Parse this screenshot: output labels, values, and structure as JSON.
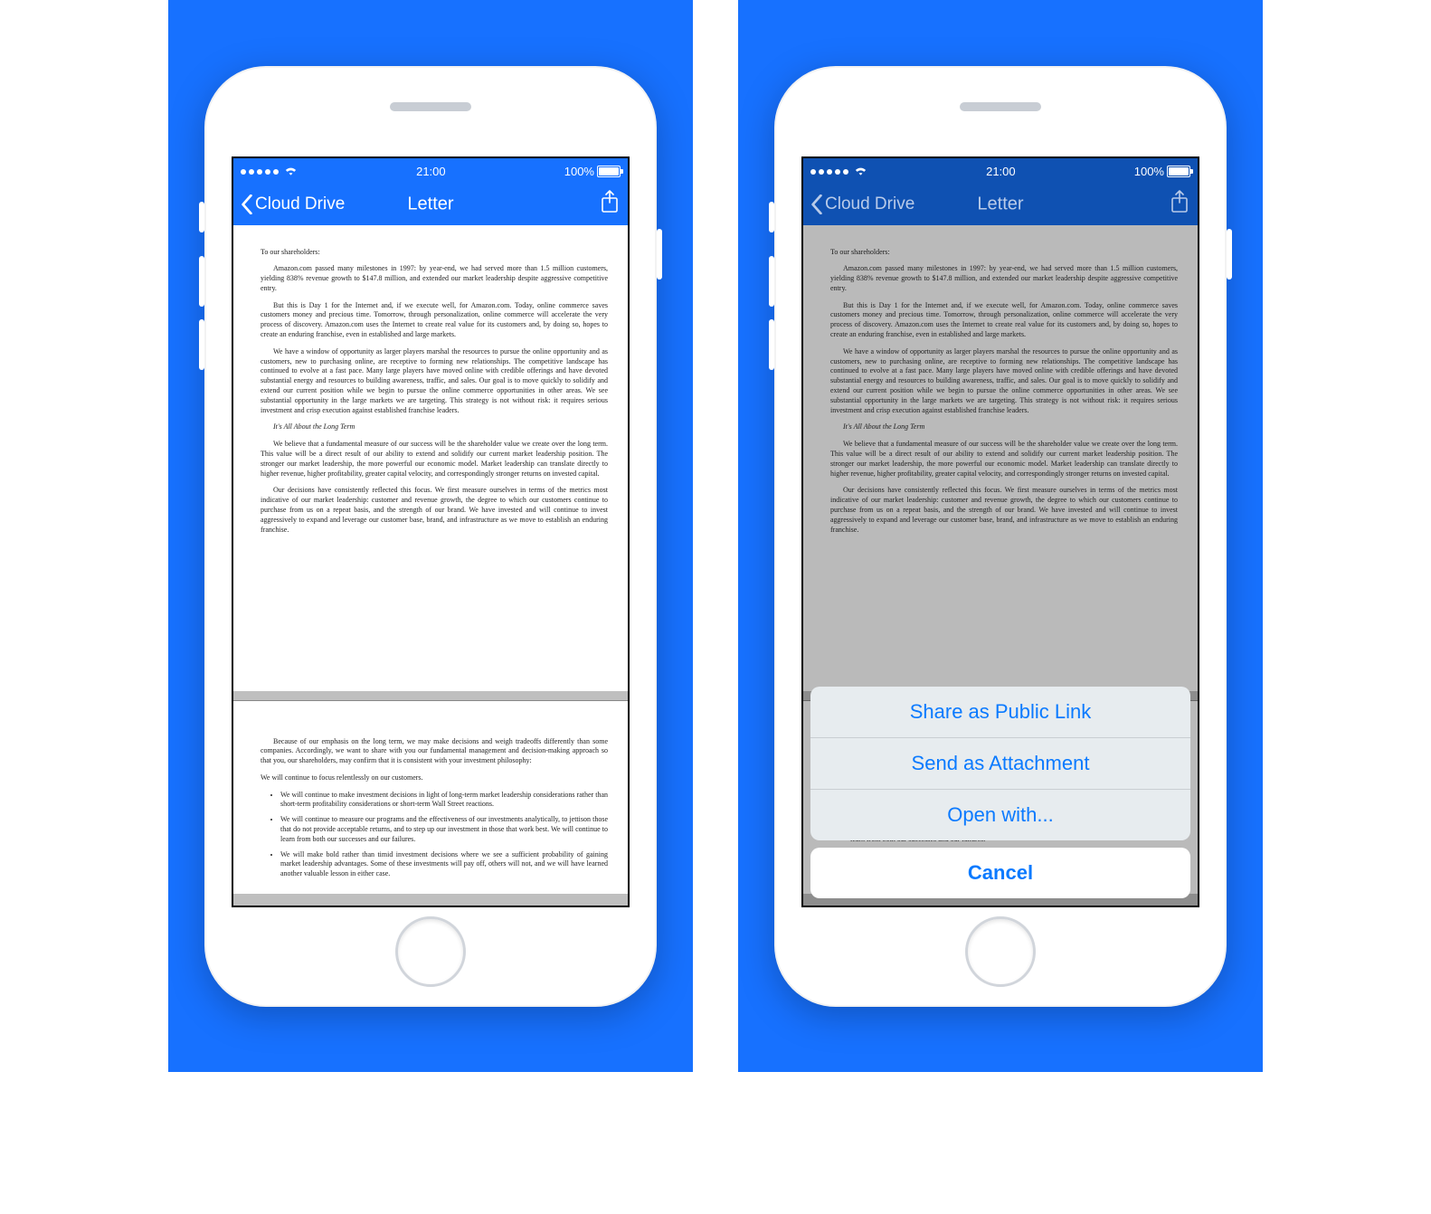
{
  "statusbar": {
    "time": "21:00",
    "battery": "100%"
  },
  "navbar": {
    "back_label": "Cloud Drive",
    "title": "Letter"
  },
  "doc": {
    "greeting": "To our shareholders:",
    "p1": "Amazon.com passed many milestones in 1997: by year-end, we had served more than 1.5 million customers, yielding 838% revenue growth to $147.8 million, and extended our market leadership despite aggressive competitive entry.",
    "p2": "But this is Day 1 for the Internet and, if we execute well, for Amazon.com. Today, online commerce saves customers money and precious time. Tomorrow, through personalization, online commerce will accelerate the very process of discovery. Amazon.com uses the Internet to create real value for its customers and, by doing so, hopes to create an enduring franchise, even in established and large markets.",
    "p3": "We have a window of opportunity as larger players marshal the resources to pursue the online opportunity and as customers, new to purchasing online, are receptive to forming new relationships. The competitive landscape has continued to evolve at a fast pace. Many large players have moved online with credible offerings and have devoted substantial energy and resources to building awareness, traffic, and sales. Our goal is to move quickly to solidify and extend our current position while we begin to pursue the online commerce opportunities in other areas. We see substantial opportunity in the large markets we are targeting. This strategy is not without risk: it requires serious investment and crisp execution against established franchise leaders.",
    "h1": "It's All About the Long Term",
    "p4": "We believe that a fundamental measure of our success will be the shareholder value we create over the long term. This value will be a direct result of our ability to extend and solidify our current market leadership position. The stronger our market leadership, the more powerful our economic model. Market leadership can translate directly to higher revenue, higher profitability, greater capital velocity, and correspondingly stronger returns on invested capital.",
    "p5": "Our decisions have consistently reflected this focus. We first measure ourselves in terms of the metrics most indicative of our market leadership: customer and revenue growth, the degree to which our customers continue to purchase from us on a repeat basis, and the strength of our brand. We have invested and will continue to invest aggressively to expand and leverage our customer base, brand, and infrastructure as we move to establish an enduring franchise.",
    "p6": "Because of our emphasis on the long term, we may make decisions and weigh tradeoffs differently than some companies. Accordingly, we want to share with you our fundamental management and decision-making approach so that you, our shareholders, may confirm that it is consistent with your investment philosophy:",
    "p7": "We will continue to focus relentlessly on our customers.",
    "b1": "We will continue to make investment decisions in light of long-term market leadership considerations rather than short-term profitability considerations or short-term Wall Street reactions.",
    "b2": "We will continue to measure our programs and the effectiveness of our investments analytically, to jettison those that do not provide acceptable returns, and to step up our investment in those that work best. We will continue to learn from both our successes and our failures.",
    "b3": "We will make bold rather than timid investment decisions where we see a sufficient probability of gaining market leadership advantages. Some of these investments will pay off, others will not, and we will have learned another valuable lesson in either case."
  },
  "actionsheet": {
    "items": [
      "Share as Public Link",
      "Send as Attachment",
      "Open with..."
    ],
    "cancel": "Cancel"
  }
}
